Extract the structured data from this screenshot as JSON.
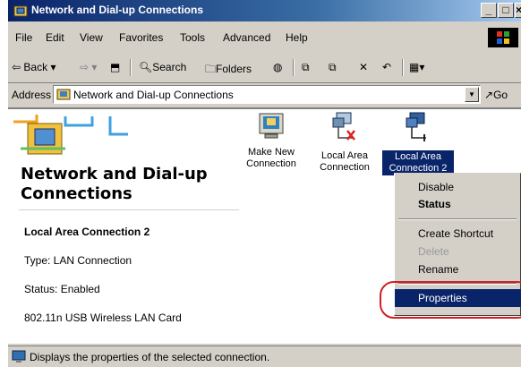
{
  "window": {
    "title": "Network and Dial-up Connections",
    "controls": [
      "_",
      "□",
      "×"
    ]
  },
  "menu": [
    "File",
    "Edit",
    "View",
    "Favorites",
    "Tools",
    "Advanced",
    "Help"
  ],
  "toolbar": {
    "back": "Back",
    "search": "Search",
    "folders": "Folders"
  },
  "address": {
    "label": "Address",
    "value": "Network and Dial-up Connections",
    "go": "Go"
  },
  "panel": {
    "title_line1": "Network and Dial-up",
    "title_line2": "Connections",
    "selected_name": "Local Area Connection 2",
    "type": "Type: LAN Connection",
    "status": "Status: Enabled",
    "device": "802.11n USB Wireless LAN Card"
  },
  "icons": [
    {
      "line1": "Make New",
      "line2": "Connection",
      "icon": "make-new-connection-icon"
    },
    {
      "line1": "Local Area",
      "line2": "Connection",
      "icon": "network-disconnected-icon"
    },
    {
      "line1": "Local Area",
      "line2": "Connection 2",
      "icon": "network-connected-icon"
    }
  ],
  "context_menu": {
    "items": [
      "Disable",
      "Status",
      "Create Shortcut",
      "Delete",
      "Rename",
      "Properties"
    ],
    "highlighted": "Properties"
  },
  "statusbar": {
    "text": "Displays the properties of the selected connection."
  },
  "colors": {
    "selection": "#0a246a",
    "annotation": "#d02020"
  }
}
